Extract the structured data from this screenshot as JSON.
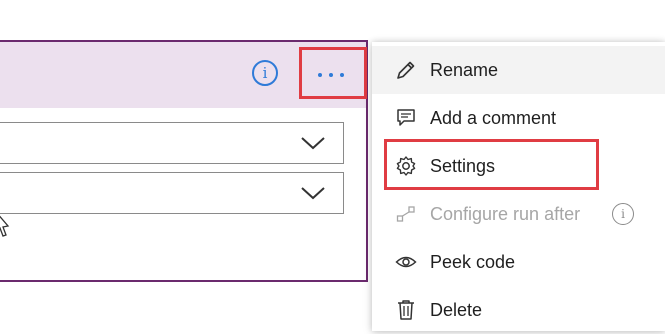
{
  "action_card": {
    "info_icon": "info-icon",
    "more_icon": "more-options-icon",
    "info_glyph": "i"
  },
  "context_menu": {
    "items": [
      {
        "label": "Rename",
        "icon": "pencil-icon"
      },
      {
        "label": "Add a comment",
        "icon": "comment-icon"
      },
      {
        "label": "Settings",
        "icon": "gear-icon"
      },
      {
        "label": "Configure run after",
        "icon": "flow-icon",
        "disabled": true,
        "trailing_icon": "info-icon"
      },
      {
        "label": "Peek code",
        "icon": "eye-icon"
      },
      {
        "label": "Delete",
        "icon": "trash-icon"
      }
    ]
  },
  "highlight_color": "#e03c43",
  "accent_color": "#2f7bd8"
}
